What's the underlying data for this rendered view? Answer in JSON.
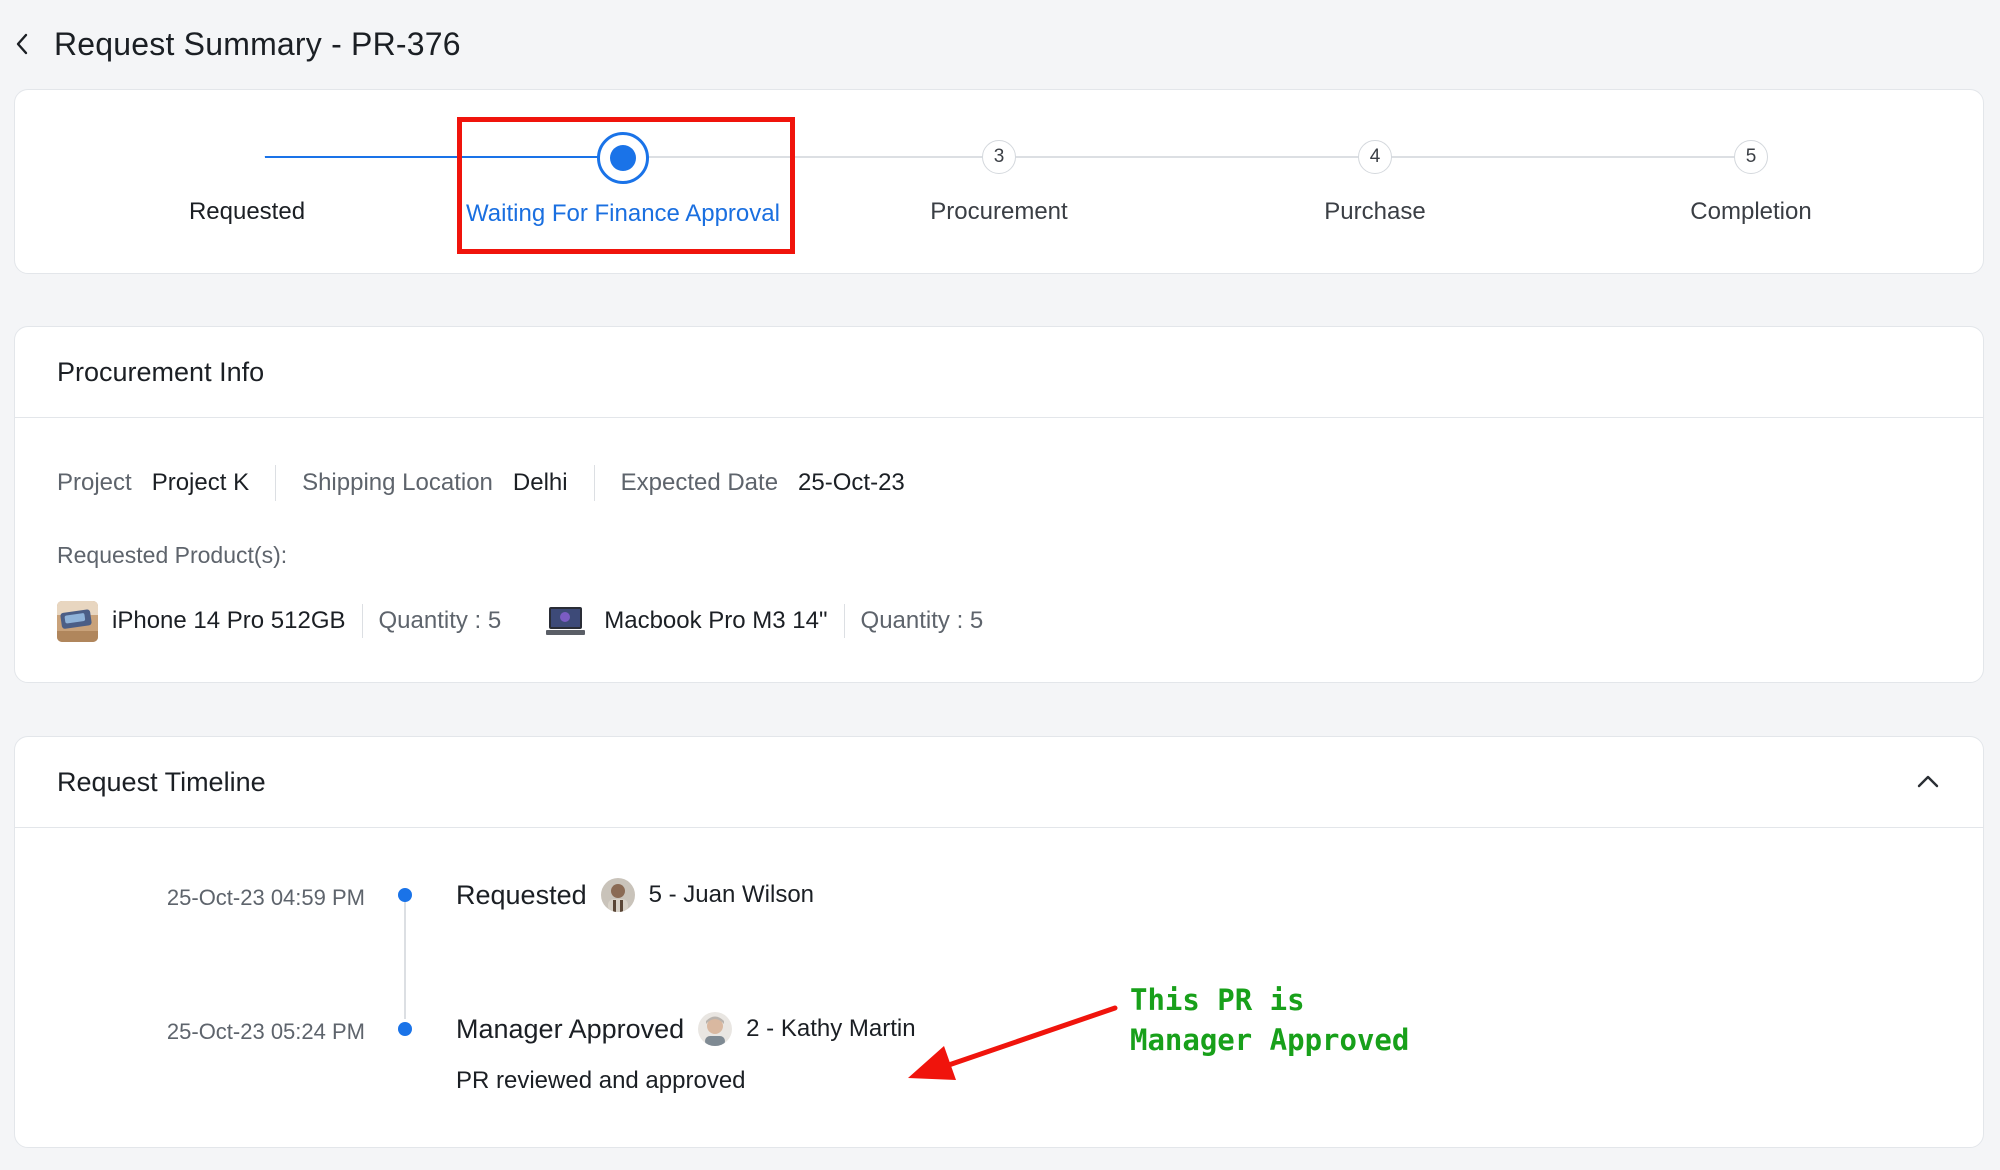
{
  "header": {
    "title": "Request Summary - PR-376"
  },
  "stepper": {
    "steps": [
      {
        "label": "Requested",
        "number": "",
        "state": "done"
      },
      {
        "label": "Waiting For Finance Approval",
        "number": "",
        "state": "active"
      },
      {
        "label": "Procurement",
        "number": "3",
        "state": "pending"
      },
      {
        "label": "Purchase",
        "number": "4",
        "state": "pending"
      },
      {
        "label": "Completion",
        "number": "5",
        "state": "pending"
      }
    ]
  },
  "procurement": {
    "title": "Procurement Info",
    "project_label": "Project",
    "project_value": "Project K",
    "shipping_label": "Shipping Location",
    "shipping_value": "Delhi",
    "date_label": "Expected Date",
    "date_value": "25-Oct-23",
    "products_label": "Requested Product(s):",
    "products": [
      {
        "name": "iPhone 14 Pro 512GB",
        "quantity": "Quantity : 5"
      },
      {
        "name": "Macbook Pro M3 14\"",
        "quantity": "Quantity : 5"
      }
    ]
  },
  "timeline": {
    "title": "Request Timeline",
    "entries": [
      {
        "time": "25-Oct-23 04:59 PM",
        "title": "Requested",
        "user": "5 - Juan Wilson",
        "note": ""
      },
      {
        "time": "25-Oct-23 05:24 PM",
        "title": "Manager Approved",
        "user": "2 - Kathy Martin",
        "note": "PR reviewed and approved"
      }
    ]
  },
  "annotation": {
    "line1": "This PR is",
    "line2": "Manager Approved"
  },
  "colors": {
    "accent": "#1a73e8",
    "highlight": "#f0140c",
    "annotation": "#18a01a"
  }
}
